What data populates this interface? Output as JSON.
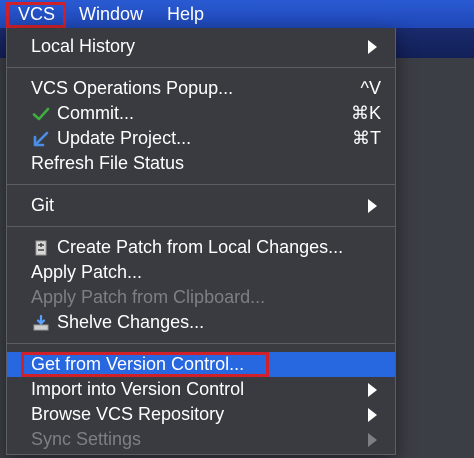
{
  "menubar": {
    "vcs": "VCS",
    "window": "Window",
    "help": "Help"
  },
  "menu": {
    "local_history": "Local History",
    "vcs_operations_popup": {
      "label": "VCS Operations Popup...",
      "shortcut": "^V"
    },
    "commit": {
      "label": "Commit...",
      "shortcut": "⌘K"
    },
    "update_project": {
      "label": "Update Project...",
      "shortcut": "⌘T"
    },
    "refresh_file_status": "Refresh File Status",
    "git": "Git",
    "create_patch": "Create Patch from Local Changes...",
    "apply_patch": "Apply Patch...",
    "apply_patch_clipboard": "Apply Patch from Clipboard...",
    "shelve_changes": "Shelve Changes...",
    "get_from_vcs": "Get from Version Control...",
    "import_into_vcs": "Import into Version Control",
    "browse_vcs_repo": "Browse VCS Repository",
    "sync_settings": "Sync Settings"
  },
  "colors": {
    "menubar_bg": "#2a5ad3",
    "menu_bg": "#393b40",
    "highlight_bg": "#2767e0",
    "outline_red": "#d0202a",
    "disabled_text": "#7d7f84",
    "commit_icon": "#3fae3f",
    "update_icon": "#4a8fe6"
  },
  "icons": {
    "commit": "checkmark-icon",
    "update_project": "down-left-arrow-icon",
    "create_patch": "patch-document-icon",
    "shelve_changes": "shelve-icon",
    "submenu": "chevron-right-icon"
  }
}
